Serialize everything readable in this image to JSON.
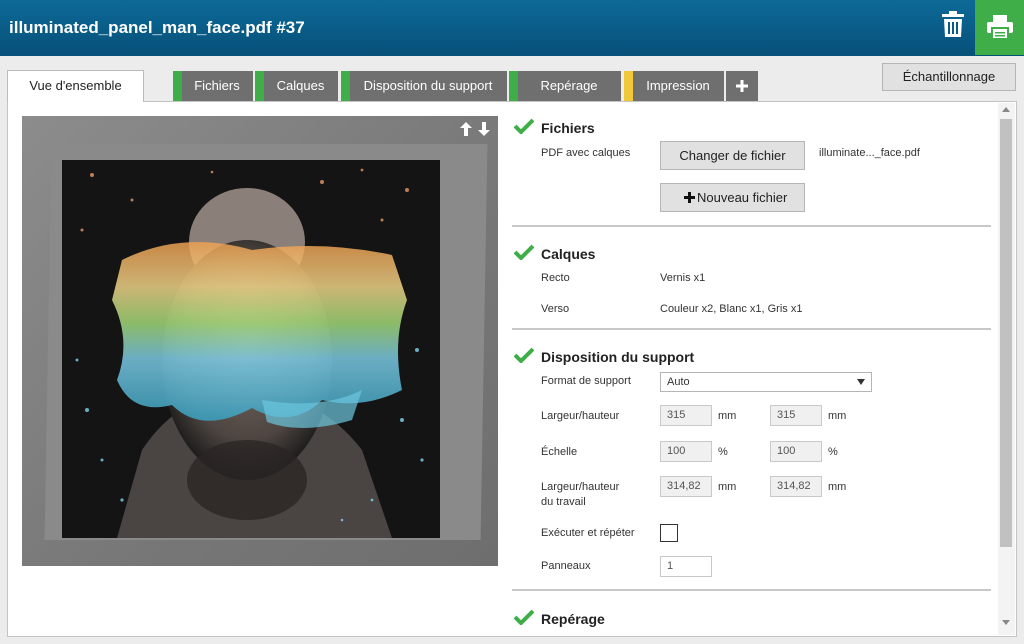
{
  "header": {
    "title": "illuminated_panel_man_face.pdf #37",
    "accent": "#3fae49",
    "bar_color": "#0a5f8c",
    "icons": [
      "trash-icon",
      "printer-icon"
    ]
  },
  "tabs": [
    {
      "label": "Vue d'ensemble",
      "active": true,
      "status_color": ""
    },
    {
      "label": "Fichiers",
      "status_color": "#3fae49"
    },
    {
      "label": "Calques",
      "status_color": "#3fae49"
    },
    {
      "label": "Disposition du support",
      "status_color": "#3fae49"
    },
    {
      "label": "Repérage",
      "status_color": "#3fae49"
    },
    {
      "label": "Impression",
      "status_color": "#f0c93a"
    }
  ],
  "tab_plus_icon": "plus-icon",
  "sampling_button": "Échantillonnage",
  "preview": {
    "icon": "up-down-arrows-icon"
  },
  "sections": {
    "fichiers": {
      "title": "Fichiers",
      "pdf_label": "PDF avec calques",
      "change_button": "Changer de fichier",
      "file_name": "illuminate..._face.pdf",
      "new_button": "Nouveau fichier"
    },
    "calques": {
      "title": "Calques",
      "recto_label": "Recto",
      "recto_value": "Vernis x1",
      "verso_label": "Verso",
      "verso_value": "Couleur x2, Blanc x1, Gris x1"
    },
    "disposition": {
      "title": "Disposition du support",
      "format_label": "Format de support",
      "format_value": "Auto",
      "size_label": "Largeur/hauteur",
      "width": "315",
      "height": "315",
      "unit_mm": "mm",
      "scale_label": "Échelle",
      "scale_x": "100",
      "scale_y": "100",
      "unit_pct": "%",
      "job_size_label_1": "Largeur/hauteur",
      "job_size_label_2": "du travail",
      "job_width": "314,82",
      "job_height": "314,82",
      "step_repeat_label": "Exécuter et répéter",
      "step_repeat_checked": false,
      "panels_label": "Panneaux",
      "panels_value": "1"
    },
    "reperage": {
      "title": "Repérage"
    }
  },
  "status_check_color": "#3fae49"
}
